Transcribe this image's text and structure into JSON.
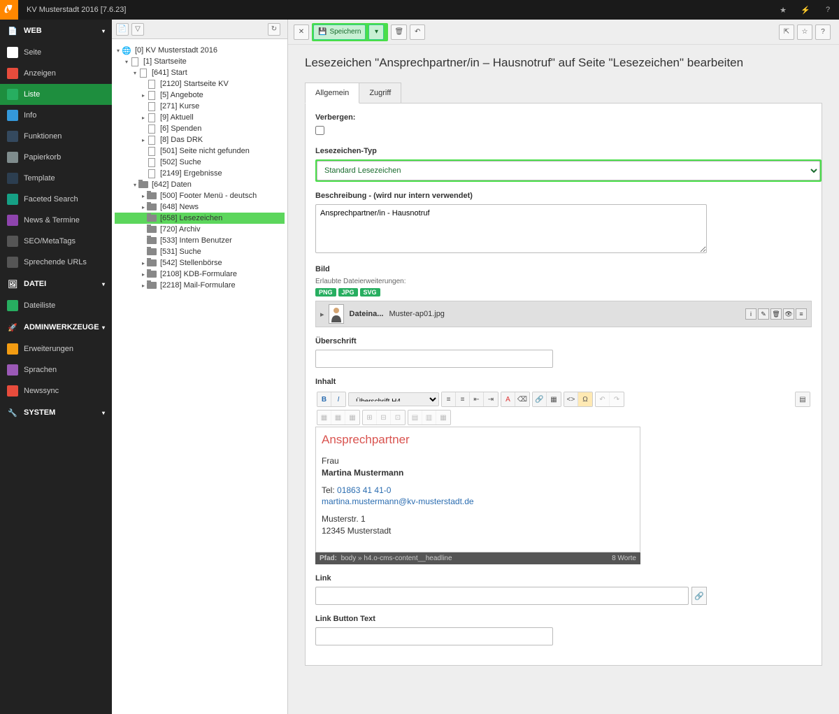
{
  "topbar": {
    "title": "KV Musterstadt 2016 [7.6.23]"
  },
  "sidebar": {
    "sections": [
      {
        "label": "WEB",
        "items": [
          {
            "label": "Seite",
            "ico": "ico-page"
          },
          {
            "label": "Anzeigen",
            "ico": "ico-view"
          },
          {
            "label": "Liste",
            "ico": "ico-list",
            "active": true
          },
          {
            "label": "Info",
            "ico": "ico-info"
          },
          {
            "label": "Funktionen",
            "ico": "ico-func"
          },
          {
            "label": "Papierkorb",
            "ico": "ico-trash"
          },
          {
            "label": "Template",
            "ico": "ico-tpl"
          },
          {
            "label": "Faceted Search",
            "ico": "ico-search"
          },
          {
            "label": "News & Termine",
            "ico": "ico-news"
          },
          {
            "label": "SEO/MetaTags",
            "ico": "ico-seo"
          },
          {
            "label": "Sprechende URLs",
            "ico": "ico-url"
          }
        ]
      },
      {
        "label": "DATEI",
        "items": [
          {
            "label": "Dateiliste",
            "ico": "ico-filelist"
          }
        ]
      },
      {
        "label": "ADMINWERKZEUGE",
        "items": [
          {
            "label": "Erweiterungen",
            "ico": "ico-ext"
          },
          {
            "label": "Sprachen",
            "ico": "ico-lang"
          },
          {
            "label": "Newssync",
            "ico": "ico-rss"
          }
        ]
      },
      {
        "label": "SYSTEM",
        "items": []
      }
    ]
  },
  "tree": [
    {
      "d": 0,
      "arrow": "▾",
      "type": "root",
      "label": "[0] KV Musterstadt 2016"
    },
    {
      "d": 1,
      "arrow": "▾",
      "type": "page",
      "label": "[1] Startseite"
    },
    {
      "d": 2,
      "arrow": "▾",
      "type": "page",
      "label": "[641] Start"
    },
    {
      "d": 3,
      "arrow": "",
      "type": "page",
      "label": "[2120] Startseite KV"
    },
    {
      "d": 3,
      "arrow": "▸",
      "type": "page",
      "label": "[5] Angebote"
    },
    {
      "d": 3,
      "arrow": "",
      "type": "page",
      "label": "[271] Kurse"
    },
    {
      "d": 3,
      "arrow": "▸",
      "type": "page",
      "label": "[9] Aktuell"
    },
    {
      "d": 3,
      "arrow": "",
      "type": "page",
      "label": "[6] Spenden"
    },
    {
      "d": 3,
      "arrow": "▸",
      "type": "page",
      "label": "[8] Das DRK"
    },
    {
      "d": 3,
      "arrow": "",
      "type": "page",
      "label": "[501] Seite nicht gefunden"
    },
    {
      "d": 3,
      "arrow": "",
      "type": "page",
      "label": "[502] Suche"
    },
    {
      "d": 3,
      "arrow": "",
      "type": "page",
      "label": "[2149] Ergebnisse"
    },
    {
      "d": 2,
      "arrow": "▾",
      "type": "folder",
      "label": "[642] Daten"
    },
    {
      "d": 3,
      "arrow": "▸",
      "type": "folder",
      "label": "[500] Footer Menü - deutsch"
    },
    {
      "d": 3,
      "arrow": "▸",
      "type": "folder",
      "label": "[648] News"
    },
    {
      "d": 3,
      "arrow": "",
      "type": "folder",
      "label": "[658] Lesezeichen",
      "hl": true
    },
    {
      "d": 3,
      "arrow": "",
      "type": "folder",
      "label": "[720] Archiv"
    },
    {
      "d": 3,
      "arrow": "",
      "type": "folder",
      "label": "[533] Intern Benutzer"
    },
    {
      "d": 3,
      "arrow": "",
      "type": "folder",
      "label": "[531] Suche"
    },
    {
      "d": 3,
      "arrow": "▸",
      "type": "folder",
      "label": "[542] Stellenbörse"
    },
    {
      "d": 3,
      "arrow": "▸",
      "type": "folder",
      "label": "[2108] KDB-Formulare"
    },
    {
      "d": 3,
      "arrow": "▸",
      "type": "folder",
      "label": "[2218] Mail-Formulare"
    }
  ],
  "doc": {
    "save_label": "Speichern",
    "title": "Lesezeichen \"Ansprechpartner/in – Hausnotruf\" auf Seite \"Lesezeichen\" bearbeiten",
    "tabs": [
      {
        "label": "Allgemein",
        "active": true
      },
      {
        "label": "Zugriff"
      }
    ],
    "hide_label": "Verbergen:",
    "type_label": "Lesezeichen-Typ",
    "type_value": "Standard Lesezeichen",
    "desc_label": "Beschreibung - (wird nur intern verwendet)",
    "desc_value": "Ansprechpartner/in - Hausnotruf",
    "image_label": "Bild",
    "allowed_label": "Erlaubte Dateierweiterungen:",
    "exts": [
      "PNG",
      "JPG",
      "SVG"
    ],
    "file_label": "Dateina...",
    "file_name": "Muster-ap01.jpg",
    "heading_label": "Überschrift",
    "content_label": "Inhalt",
    "block_format": "Überschrift H4",
    "rte": {
      "heading": "Ansprechpartner",
      "line1": "Frau",
      "line2": "Martina Mustermann",
      "tel_pre": "Tel: ",
      "tel": "01863 41 41-0",
      "email": "martina.mustermann@kv-musterstadt.de",
      "addr1": "Musterstr. 1",
      "addr2": "12345 Musterstadt"
    },
    "rte_path_label": "Pfad:",
    "rte_path": "body » h4.o-cms-content__headline",
    "rte_words": "8 Worte",
    "link_label": "Link",
    "link_button_label": "Link Button Text"
  }
}
